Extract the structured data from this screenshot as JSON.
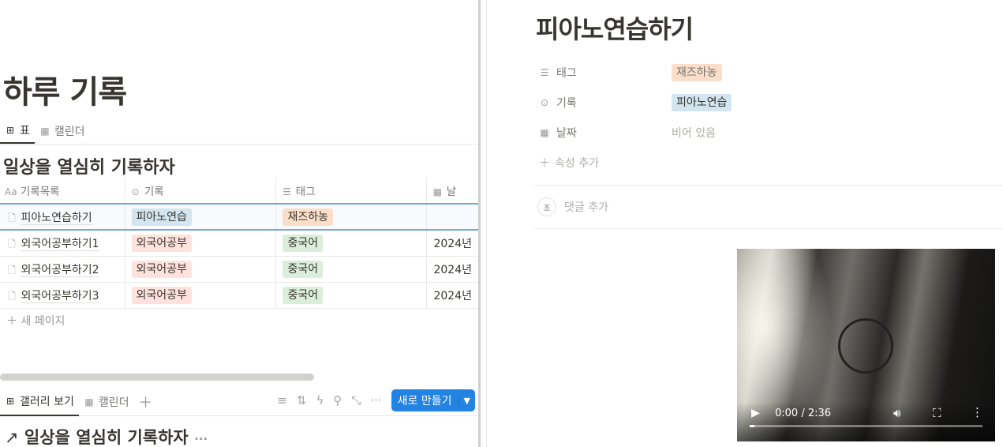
{
  "left": {
    "page_title": "하루 기록",
    "tabs": [
      {
        "label": "표",
        "icon": "table-icon"
      },
      {
        "label": "캘린더",
        "icon": "calendar-icon"
      }
    ],
    "db_title": "일상을 열심히 기록하자",
    "columns": [
      {
        "label": "기록목록",
        "icon": "Aa"
      },
      {
        "label": "기록",
        "icon": "select-icon"
      },
      {
        "label": "태그",
        "icon": "list-icon"
      },
      {
        "label": "날",
        "icon": "calendar-icon"
      }
    ],
    "rows": [
      {
        "name": "피아노연습하기",
        "record": "피아노연습",
        "record_color": "blue",
        "tag": "재즈하농",
        "tag_color": "orange",
        "date": ""
      },
      {
        "name": "외국어공부하기1",
        "record": "외국어공부",
        "record_color": "red",
        "tag": "중국어",
        "tag_color": "green",
        "date": "2024년"
      },
      {
        "name": "외국어공부하기2",
        "record": "외국어공부",
        "record_color": "red",
        "tag": "중국어",
        "tag_color": "green",
        "date": "2024년"
      },
      {
        "name": "외국어공부하기3",
        "record": "외국어공부",
        "record_color": "red",
        "tag": "중국어",
        "tag_color": "green",
        "date": "2024년"
      }
    ],
    "new_page": "새 페이지",
    "tabs2": [
      {
        "label": "갤러리 보기",
        "icon": "gallery-icon"
      },
      {
        "label": "캘린더",
        "icon": "calendar-icon"
      }
    ],
    "new_button": "새로 만들기",
    "db_title2": "일상을 열심히 기록하자"
  },
  "right": {
    "title": "피아노연습하기",
    "props": [
      {
        "label": "태그",
        "value": "재즈하농",
        "color": "orange"
      },
      {
        "label": "기록",
        "value": "피아노연습",
        "color": "blue"
      },
      {
        "label": "날짜",
        "value": "비어 있음"
      }
    ],
    "add_property": "속성 추가",
    "comment_avatar": "조",
    "add_comment": "댓글 추가",
    "video": {
      "time": "0:00 / 2:36",
      "progress": 0.0
    }
  },
  "colors": {
    "accent": "#2383e2",
    "blue": "#d3e5ef",
    "red": "#ffe2dd",
    "green": "#dbeddb",
    "orange": "#fadec9"
  }
}
